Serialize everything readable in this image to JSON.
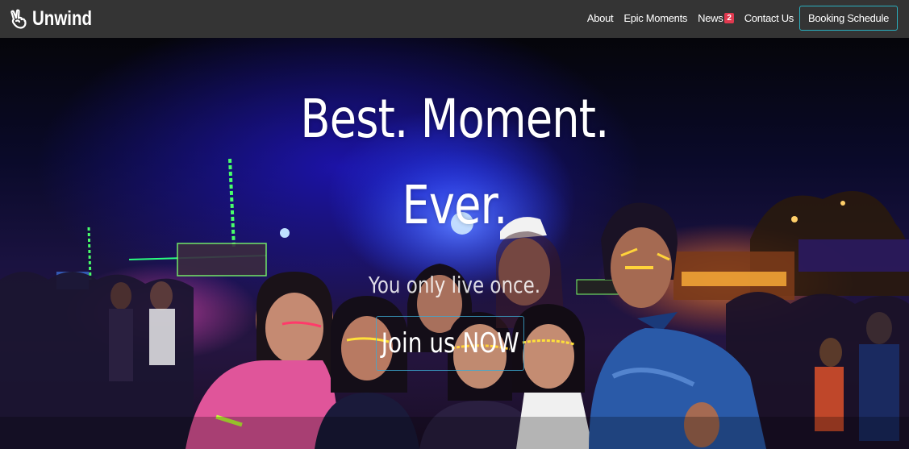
{
  "navbar": {
    "brand": {
      "icon": "peace-hand-icon",
      "name": "Unwind"
    },
    "links": [
      {
        "label": "About"
      },
      {
        "label": "Epic Moments"
      },
      {
        "label": "News",
        "badge": "2"
      },
      {
        "label": "Contact Us"
      }
    ],
    "booking_button": "Booking Schedule",
    "colors": {
      "background": "#343434",
      "badge": "#e0394f",
      "button_border": "#2ab0c0"
    }
  },
  "hero": {
    "title_line1": "Best. Moment.",
    "title_line2": "Ever.",
    "subtitle": "You only live once.",
    "cta_label": "Join us NOW"
  }
}
